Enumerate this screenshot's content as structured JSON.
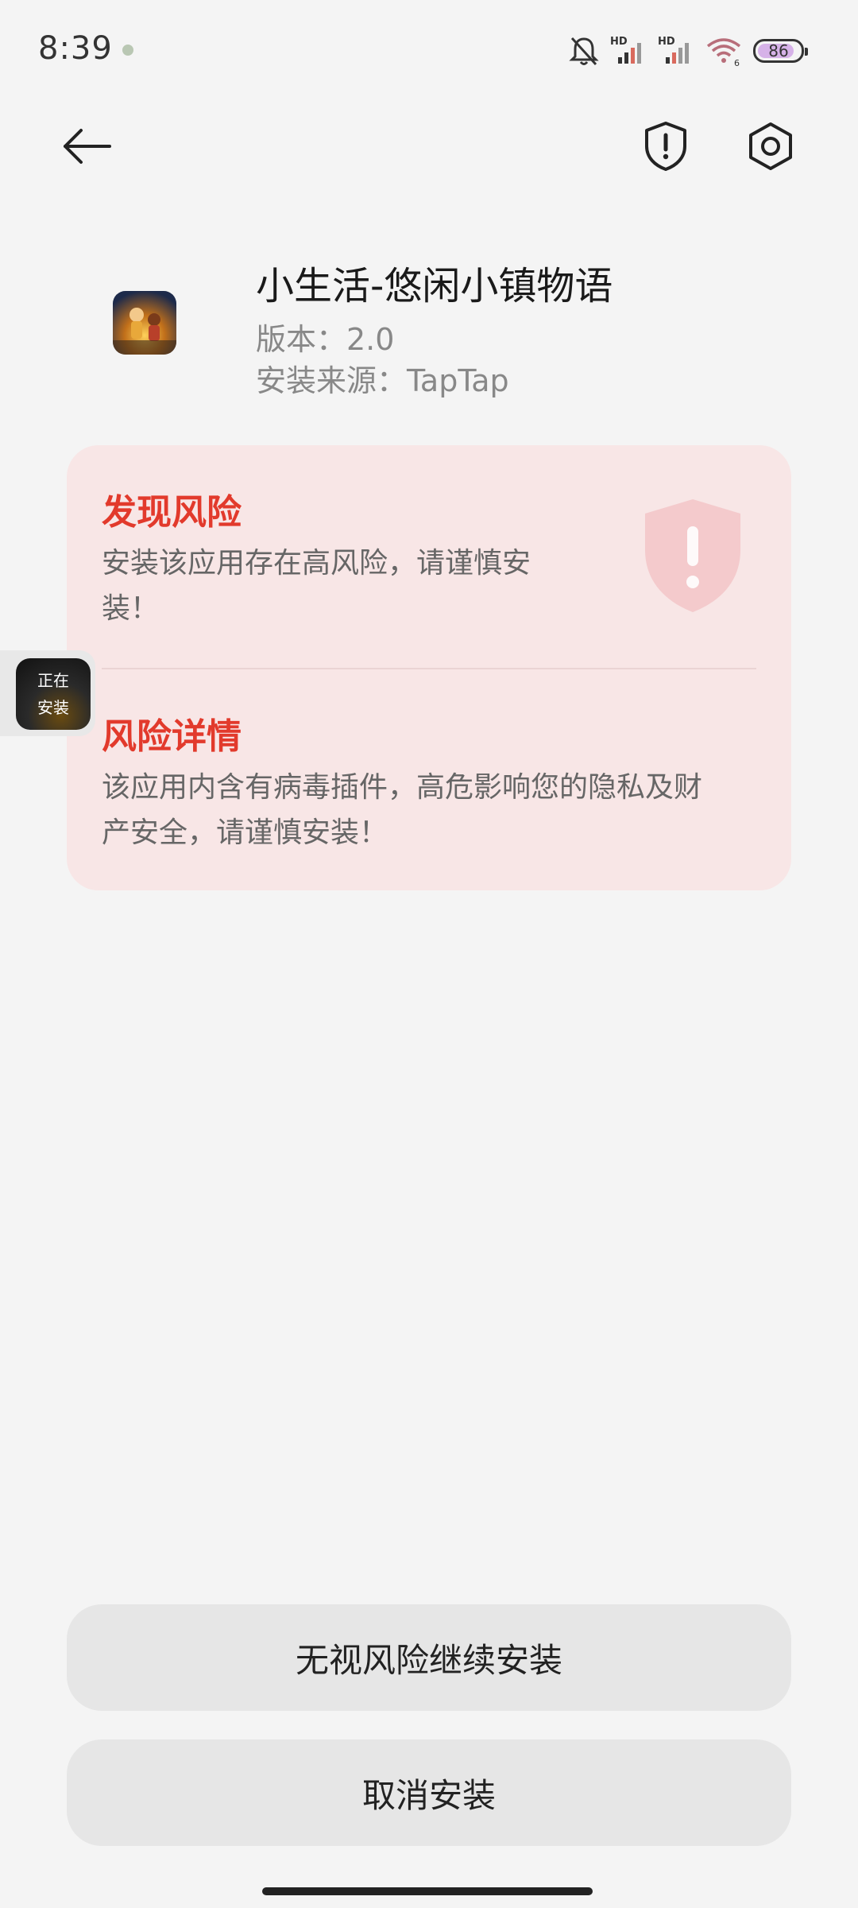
{
  "status_bar": {
    "time": "8:39",
    "battery_level": "86",
    "battery_fraction": 0.86,
    "icons": [
      "bell-muted-icon",
      "hd-signal-icon",
      "hd-signal-icon",
      "wifi-icon",
      "battery-icon"
    ]
  },
  "app": {
    "name": "小生活-悠闲小镇物语",
    "version": "版本：2.0",
    "source": "安装来源：TapTap"
  },
  "risk": {
    "found_title": "发现风险",
    "found_line1": "安装该应用存在高风险，请谨慎安",
    "found_line2": "装！",
    "detail_title": "风险详情",
    "detail_line1": "该应用内含有病毒插件，高危影响您的隐私及财",
    "detail_line2": "产安全，请谨慎安装！"
  },
  "floating_install": {
    "line1": "正在",
    "line2": "安装"
  },
  "buttons": {
    "continue_label": "无视风险继续安装",
    "cancel_label": "取消安装"
  },
  "colors": {
    "accent_red": "#e23a2c",
    "card_bg": "#f8e6e6",
    "page_bg": "#f4f4f4"
  }
}
